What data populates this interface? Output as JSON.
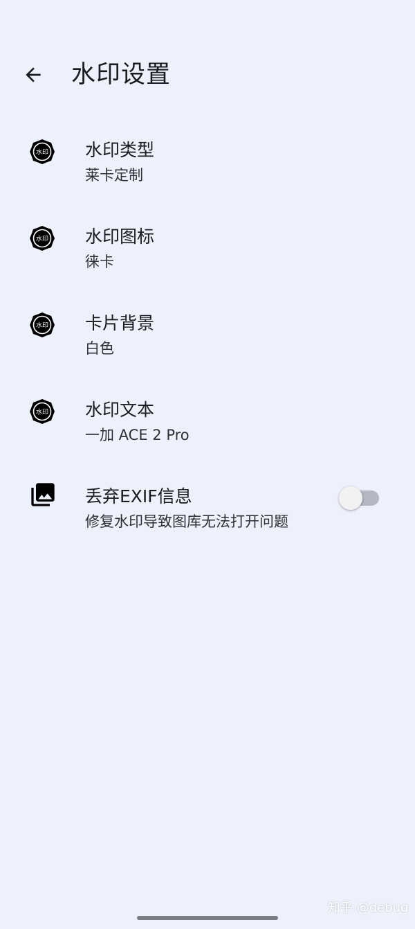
{
  "app_bar": {
    "title": "水印设置",
    "back_icon": "arrow-back-icon"
  },
  "settings": [
    {
      "icon": "watermark-badge-icon",
      "icon_text": "水印",
      "title": "水印类型",
      "summary": "莱卡定制"
    },
    {
      "icon": "watermark-badge-icon",
      "icon_text": "水印",
      "title": "水印图标",
      "summary": "徕卡"
    },
    {
      "icon": "watermark-badge-icon",
      "icon_text": "水印",
      "title": "卡片背景",
      "summary": "白色"
    },
    {
      "icon": "watermark-badge-icon",
      "icon_text": "水印",
      "title": "水印文本",
      "summary": "一加 ACE 2 Pro"
    },
    {
      "icon": "photo-library-icon",
      "title": "丢弃EXIF信息",
      "summary": "修复水印导致图库无法打开问题",
      "toggle_on": false
    }
  ],
  "overlay_watermark": "知乎 @debug",
  "colors": {
    "background": "#EDF1FC",
    "text_primary": "#1B1B1F",
    "text_secondary": "#2F3036",
    "toggle_track_off": "#B4B7C1",
    "toggle_thumb_off": "#F2F2F2"
  }
}
